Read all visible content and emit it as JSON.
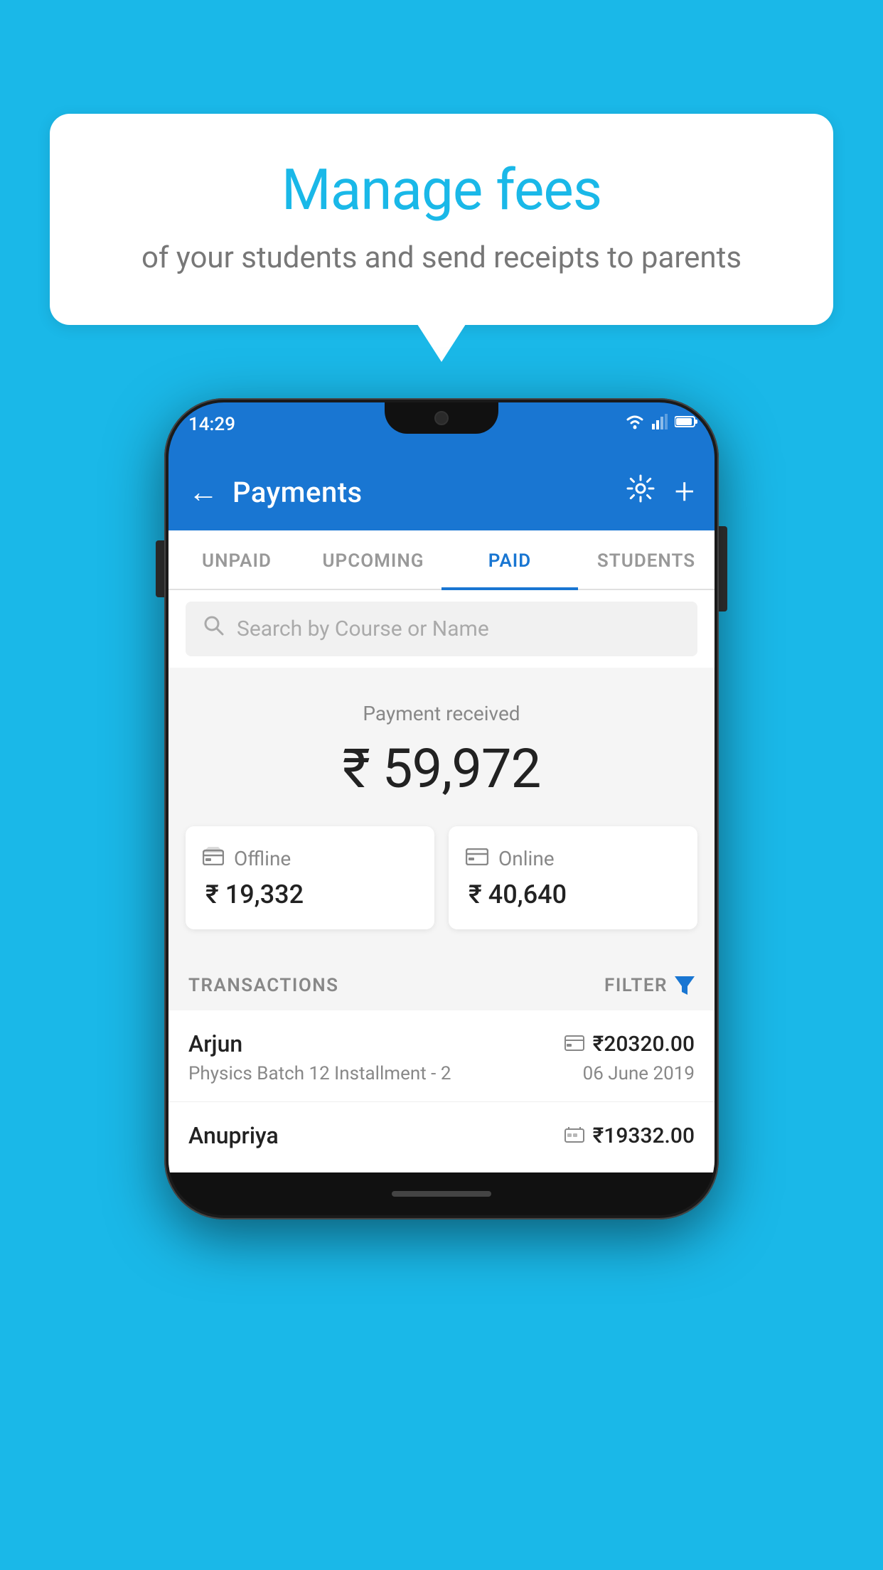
{
  "background_color": "#1ab8e8",
  "speech_bubble": {
    "title": "Manage fees",
    "subtitle": "of your students and send receipts to parents"
  },
  "status_bar": {
    "time": "14:29",
    "wifi": "▾",
    "signal": "▲",
    "battery": "▮"
  },
  "app_bar": {
    "title": "Payments",
    "back_label": "←",
    "settings_label": "⚙",
    "add_label": "+"
  },
  "tabs": [
    {
      "label": "UNPAID",
      "active": false
    },
    {
      "label": "UPCOMING",
      "active": false
    },
    {
      "label": "PAID",
      "active": true
    },
    {
      "label": "STUDENTS",
      "active": false
    }
  ],
  "search": {
    "placeholder": "Search by Course or Name"
  },
  "payment_summary": {
    "label": "Payment received",
    "amount": "₹ 59,972",
    "offline": {
      "type": "Offline",
      "amount": "₹ 19,332"
    },
    "online": {
      "type": "Online",
      "amount": "₹ 40,640"
    }
  },
  "transactions": {
    "header_label": "TRANSACTIONS",
    "filter_label": "FILTER",
    "items": [
      {
        "name": "Arjun",
        "course": "Physics Batch 12 Installment - 2",
        "amount": "₹20320.00",
        "date": "06 June 2019",
        "type": "online"
      },
      {
        "name": "Anupriya",
        "course": "",
        "amount": "₹19332.00",
        "date": "",
        "type": "offline"
      }
    ]
  }
}
